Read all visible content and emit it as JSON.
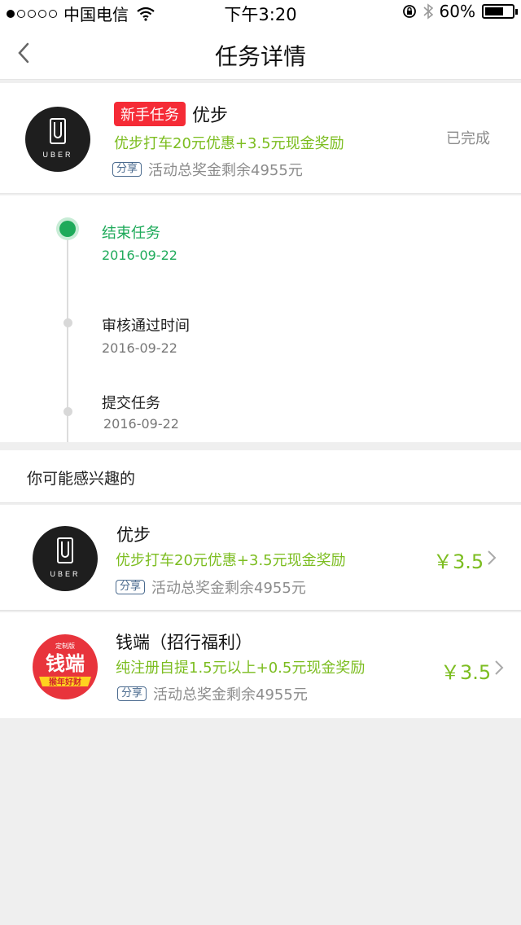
{
  "status_bar": {
    "carrier": "中国电信",
    "time": "下午3:20",
    "battery": "60%"
  },
  "nav": {
    "title": "任务详情"
  },
  "task": {
    "tag": "新手任务",
    "name": "优步",
    "desc": "优步打车20元优惠+3.5元现金奖励",
    "share": "分享",
    "remain": "活动总奖金剩余4955元",
    "status": "已完成",
    "logo_text": "UBER"
  },
  "timeline": [
    {
      "label": "结束任务",
      "date": "2016-09-22"
    },
    {
      "label": "审核通过时间",
      "date": "2016-09-22"
    },
    {
      "label": "提交任务",
      "date": "2016-09-22"
    }
  ],
  "recommend": {
    "header": "你可能感兴趣的",
    "items": [
      {
        "name": "优步",
        "desc": "优步打车20元优惠+3.5元现金奖励",
        "share": "分享",
        "remain": "活动总奖金剩余4955元",
        "price": "￥3.5",
        "logo_text": "UBER"
      },
      {
        "name": "钱端（招行福利）",
        "desc": "纯注册自提1.5元以上+0.5元现金奖励",
        "share": "分享",
        "remain": "活动总奖金剩余4955元",
        "price": "￥3.5",
        "logo_top": "定制版",
        "logo_main": "钱端",
        "logo_bottom": "猴年好财"
      }
    ]
  },
  "colors": {
    "green": "#7cbd20",
    "timeline_green": "#1eaa5a",
    "tag_red": "#f52b36"
  }
}
